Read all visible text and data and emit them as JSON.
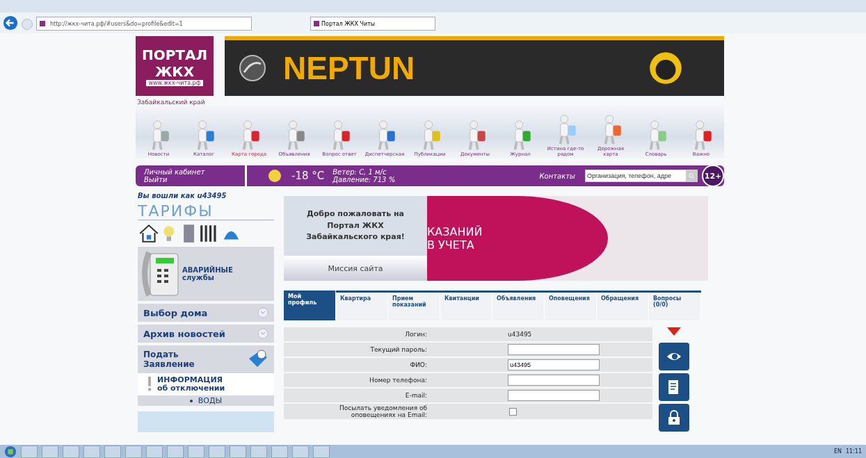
{
  "browser": {
    "url": "http://жкх-чита.рф/#users&do=profile&edit=1",
    "tab_title": "Портал ЖКХ Читы"
  },
  "logo": {
    "line1": "ПОРТАЛ",
    "line2": "ЖКХ",
    "site": "www.жкх-чита.рф"
  },
  "banner": {
    "brand": "NEPTUN"
  },
  "region": "Забайкальский край",
  "nav": [
    {
      "label": "Новости",
      "selected": false
    },
    {
      "label": "Каталог",
      "selected": false
    },
    {
      "label": "Карта города",
      "selected": true
    },
    {
      "label": "Объявления",
      "selected": false
    },
    {
      "label": "Вопрос ответ",
      "selected": false
    },
    {
      "label": "Диспетчерская",
      "selected": false
    },
    {
      "label": "Публикации",
      "selected": false
    },
    {
      "label": "Документы",
      "selected": false
    },
    {
      "label": "Журнал",
      "selected": false
    },
    {
      "label": "Истина где-то рядом",
      "selected": false
    },
    {
      "label": "Дорожная карта",
      "selected": false
    },
    {
      "label": "Словарь",
      "selected": false
    },
    {
      "label": "Важно",
      "selected": false
    }
  ],
  "bar": {
    "cabinet": "Личный кабинет",
    "logout": "Выйти",
    "temperature": "-18 °C",
    "wind": "Ветер: С, 1 м/с",
    "pressure": "Давление: 713 %",
    "contacts": "Контакты",
    "search_placeholder": "Организация, телефон, адре",
    "age": "12+"
  },
  "logged_in": "Вы вошли как u43495",
  "sidebar": {
    "tariffs": "ТАРИФЫ",
    "emergency_1": "АВАРИЙНЫЕ",
    "emergency_2": "службы",
    "menu": [
      {
        "label": "Выбор дома"
      },
      {
        "label": "Архив новостей"
      }
    ],
    "application_1": "Подать",
    "application_2": "Заявление",
    "outage_1": "ИНФОРМАЦИЯ",
    "outage_2": "об отключении",
    "outage_item": "ВОДЫ"
  },
  "welcome": {
    "text": "Добро пожаловать на Портал ЖКХ Забайкальского края!",
    "mission": "Миссия сайта"
  },
  "slide": {
    "line1": "КАЗАНИЙ",
    "line2": "В УЧЕТА"
  },
  "tabs": [
    {
      "label": "Мой профиль",
      "selected": true
    },
    {
      "label": "Квартира",
      "selected": false
    },
    {
      "label": "Прием показаний",
      "selected": false
    },
    {
      "label": "Квитанции",
      "selected": false
    },
    {
      "label": "Объявления",
      "selected": false
    },
    {
      "label": "Оповещения",
      "selected": false
    },
    {
      "label": "Обращения",
      "selected": false
    },
    {
      "label": "Вопросы (0/0)",
      "selected": false
    }
  ],
  "form": [
    {
      "kind": "text",
      "label": "Логин:",
      "value": "u43495"
    },
    {
      "kind": "input",
      "label": "Текущий пароль:"
    },
    {
      "kind": "input",
      "label": "ФИО:",
      "value": "u43495"
    },
    {
      "kind": "input",
      "label": "Номер телефона:"
    },
    {
      "kind": "input",
      "label": "E-mail:"
    },
    {
      "kind": "checkbox",
      "label": "Посылать уведомления об оповещениях на Email:",
      "checked": false
    }
  ],
  "taskbar": {
    "language": "EN",
    "time": "11:11"
  }
}
